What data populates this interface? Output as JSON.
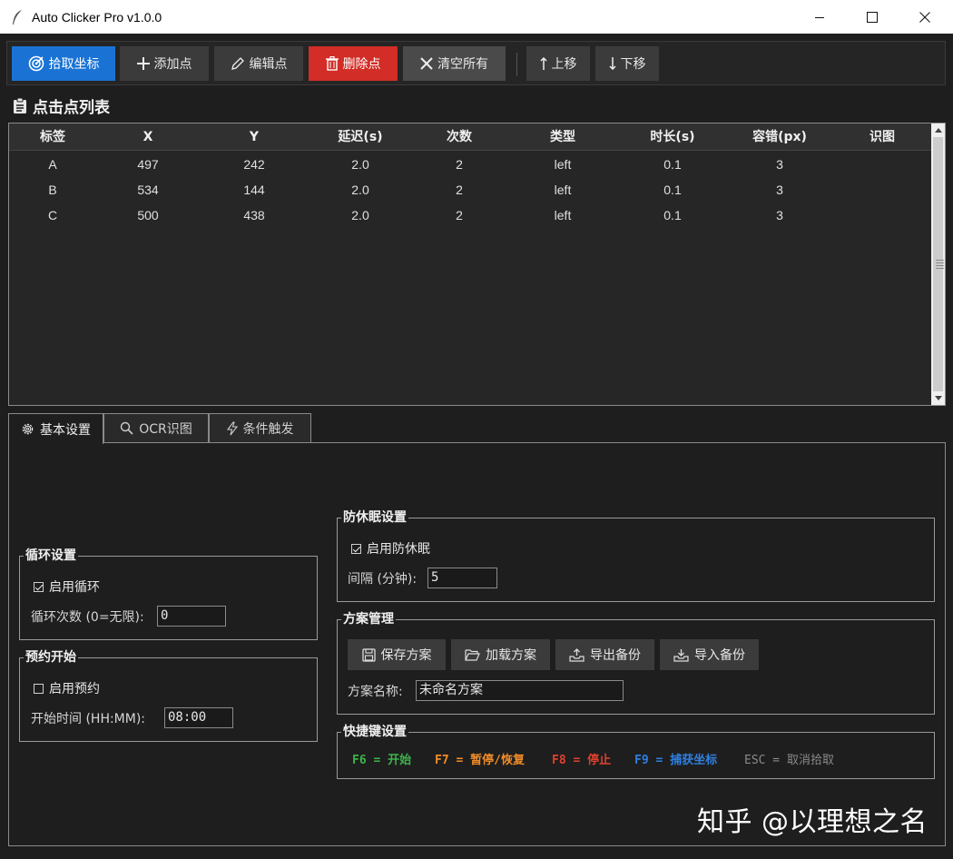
{
  "window": {
    "title": "Auto Clicker Pro v1.0.0"
  },
  "toolbar": {
    "pick_label": "拾取坐标",
    "add_label": "添加点",
    "edit_label": "编辑点",
    "delete_label": "删除点",
    "clear_label": "清空所有",
    "up_label": "上移",
    "down_label": "下移"
  },
  "list": {
    "heading": "点击点列表",
    "columns": [
      "标签",
      "X",
      "Y",
      "延迟(s)",
      "次数",
      "类型",
      "时长(s)",
      "容错(px)",
      "识图"
    ],
    "rows": [
      [
        "A",
        "497",
        "242",
        "2.0",
        "2",
        "left",
        "0.1",
        "3",
        ""
      ],
      [
        "B",
        "534",
        "144",
        "2.0",
        "2",
        "left",
        "0.1",
        "3",
        ""
      ],
      [
        "C",
        "500",
        "438",
        "2.0",
        "2",
        "left",
        "0.1",
        "3",
        ""
      ]
    ]
  },
  "tabs": [
    "基本设置",
    "OCR识图",
    "条件触发"
  ],
  "loop": {
    "legend": "循环设置",
    "enable_label": "启用循环",
    "enabled": true,
    "count_label": "循环次数 (0=无限):",
    "count_value": "0"
  },
  "schedule": {
    "legend": "预约开始",
    "enable_label": "启用预约",
    "enabled": false,
    "time_label": "开始时间 (HH:MM):",
    "time_value": "08:00"
  },
  "antisleep": {
    "legend": "防休眠设置",
    "enable_label": "启用防休眠",
    "enabled": true,
    "interval_label": "间隔 (分钟):",
    "interval_value": "5"
  },
  "profile": {
    "legend": "方案管理",
    "save_label": "保存方案",
    "load_label": "加载方案",
    "export_label": "导出备份",
    "import_label": "导入备份",
    "name_label": "方案名称:",
    "name_value": "未命名方案"
  },
  "hotkeys": {
    "legend": "快捷键设置",
    "items": [
      {
        "text": "F6 = 开始",
        "color": "#3cb44b"
      },
      {
        "text": "F7 = 暂停/恢复",
        "color": "#f28c28"
      },
      {
        "text": "F8 = 停止",
        "color": "#e0402f"
      },
      {
        "text": "F9 = 捕获坐标",
        "color": "#2f7fe0"
      },
      {
        "text": "ESC = 取消拾取",
        "color": "#8a8a8a"
      }
    ]
  },
  "watermark": "知乎 @以理想之名"
}
